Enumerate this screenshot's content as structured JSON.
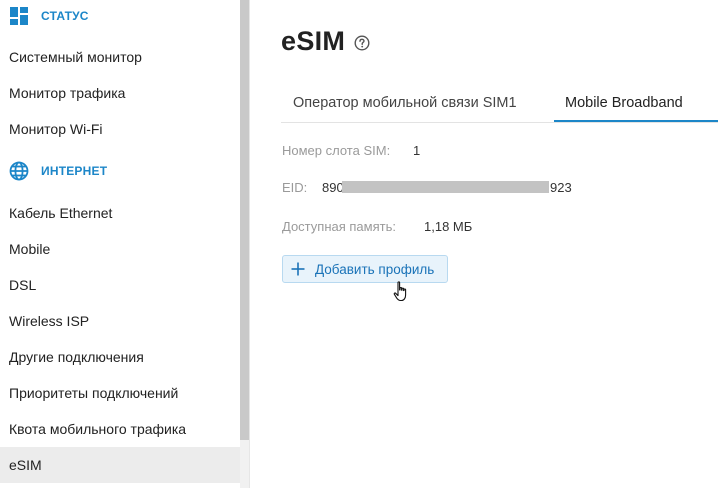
{
  "sidebar": {
    "sections": [
      {
        "label": "СТАТУС",
        "icon": "dashboard-grid-icon"
      },
      {
        "label": "ИНТЕРНЕТ",
        "icon": "globe-icon"
      }
    ],
    "status_items": [
      {
        "label": "Системный монитор"
      },
      {
        "label": "Монитор трафика"
      },
      {
        "label": "Монитор Wi-Fi"
      }
    ],
    "internet_items": [
      {
        "label": "Кабель Ethernet"
      },
      {
        "label": "Mobile"
      },
      {
        "label": "DSL"
      },
      {
        "label": "Wireless ISP"
      },
      {
        "label": "Другие подключения"
      },
      {
        "label": "Приоритеты подключений"
      },
      {
        "label": "Квота мобильного трафика"
      },
      {
        "label": "eSIM",
        "active": true
      }
    ]
  },
  "main": {
    "title": "eSIM",
    "help_icon": "question-circle-icon",
    "tabs": [
      {
        "label": "Оператор мобильной связи SIM1"
      },
      {
        "label": "Mobile Broadband",
        "active": true
      }
    ],
    "fields": {
      "slot_label": "Номер слота SIM:",
      "slot_value": "1",
      "eid_label": "EID:",
      "eid_prefix": "890",
      "eid_suffix": "923",
      "memory_label": "Доступная память:",
      "memory_value": "1,18 МБ"
    },
    "add_profile_button": "Добавить профиль"
  },
  "colors": {
    "accent": "#1c86c8",
    "button_bg": "#e8f3fb",
    "active_nav_bg": "#ececec"
  }
}
